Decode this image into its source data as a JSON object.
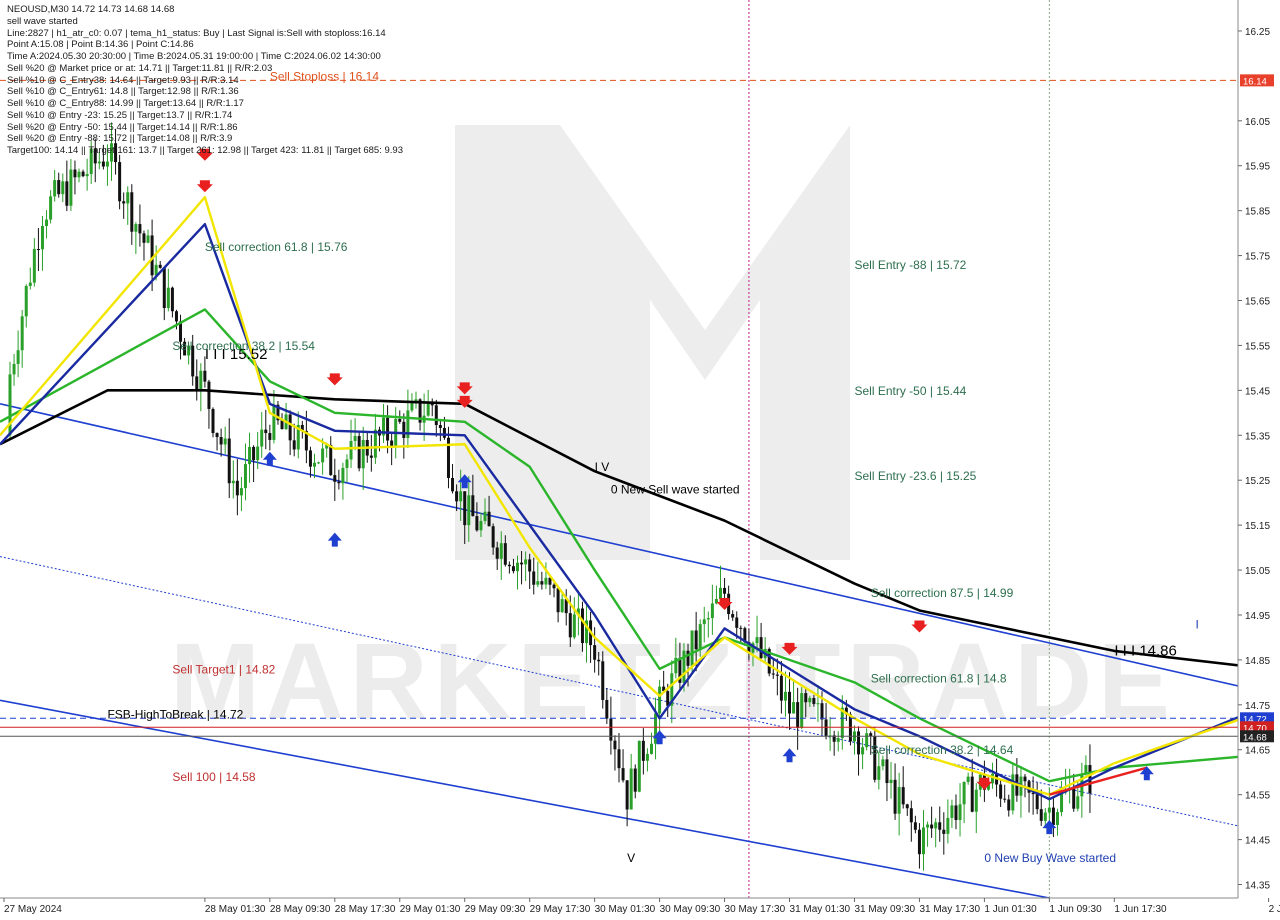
{
  "header": {
    "symbol_line": "NEOUSD,M30  14.72 14.73 14.68 14.68",
    "status": "sell wave started",
    "lines": [
      "Line:2827 | h1_atr_c0: 0.07 | tema_h1_status: Buy | Last Signal is:Sell with stoploss:16.14",
      "Point A:15.08 | Point B:14.36 | Point C:14.86",
      "Time A:2024.05.30 20:30:00 | Time B:2024.05.31 19:00:00 | Time C:2024.06.02 14:30:00",
      "Sell %20 @ Market price or at: 14.71 || Target:11.81 || R/R:2.03",
      "Sell %10 @ C_Entry38: 14.64 || Target:9.93 || R/R:3.14",
      "Sell %10 @ C_Entry61: 14.8 || Target:12.98 || R/R:1.36",
      "Sell %10 @ C_Entry88: 14.99 || Target:13.64 || R/R:1.17",
      "Sell %10 @ Entry -23: 15.25 || Target:13.7 || R/R:1.74",
      "Sell %20 @ Entry -50: 15.44 || Target:14.14 || R/R:1.86",
      "Sell %20 @ Entry -88: 15.72 || Target:14.08 || R/R:3.9",
      "Target100: 14.14 || Target 161: 13.7 || Target 261: 12.98 || Target 423: 11.81 || Target 685: 9.93"
    ]
  },
  "watermark": "MARKETZITRADE",
  "annotations": [
    {
      "text": "Sell Stoploss | 16.14",
      "x": "28 May 09:30",
      "price": 16.14,
      "color": "#e0501a"
    },
    {
      "text": "Sell correction 61.8 | 15.76",
      "x": "28 May 01:30",
      "price": 15.76,
      "color": "#2d6e4e"
    },
    {
      "text": "I I I 15.52",
      "x": "28 May 01:30",
      "price": 15.52,
      "color": "#000000"
    },
    {
      "text": "Sell correction 38.2 | 15.54",
      "x": "27 May 21:30",
      "price": 15.54,
      "color": "#2d6e4e"
    },
    {
      "text": "Sell Entry -88 | 15.72",
      "x": "31 May 09:30",
      "price": 15.72,
      "color": "#2d6e4e"
    },
    {
      "text": "Sell Entry -50 | 15.44",
      "x": "31 May 09:30",
      "price": 15.44,
      "color": "#2d6e4e"
    },
    {
      "text": "Sell Entry -23.6 | 15.25",
      "x": "31 May 09:30",
      "price": 15.25,
      "color": "#2d6e4e"
    },
    {
      "text": "I V",
      "x": "30 May 01:30",
      "price": 15.27,
      "color": "#000000"
    },
    {
      "text": "0 New Sell wave started",
      "x": "30 May 03:30",
      "price": 15.22,
      "color": "#000000"
    },
    {
      "text": "Sell correction 87.5 | 14.99",
      "x": "31 May 11:30",
      "price": 14.99,
      "color": "#2d6e4e"
    },
    {
      "text": "I I I 14.86",
      "x": "1 Jun 17:30",
      "price": 14.86,
      "color": "#000000"
    },
    {
      "text": "I",
      "x": "2 Jun 03:30",
      "price": 14.92,
      "color": "#1f3fb0"
    },
    {
      "text": "Sell Target1 | 14.82",
      "x": "27 May 21:30",
      "price": 14.82,
      "color": "#c03030"
    },
    {
      "text": "Sell correction 61.8 | 14.8",
      "x": "31 May 11:30",
      "price": 14.8,
      "color": "#2d6e4e"
    },
    {
      "text": "FSB-HighToBreak | 14.72",
      "x": "27 May 13:30",
      "price": 14.72,
      "color": "#000000"
    },
    {
      "text": "Sell correction 38.2 | 14.64",
      "x": "31 May 11:30",
      "price": 14.64,
      "color": "#2d6e4e"
    },
    {
      "text": "Sell 100 | 14.58",
      "x": "27 May 21:30",
      "price": 14.58,
      "color": "#c03030"
    },
    {
      "text": "V",
      "x": "30 May 05:30",
      "price": 14.4,
      "color": "#000000"
    },
    {
      "text": "0 New Buy Wave started",
      "x": "1 Jun 01:30",
      "price": 14.4,
      "color": "#1f3fb0"
    }
  ],
  "price_badges": [
    {
      "label": "16.14",
      "price": 16.14,
      "bg": "#e8402a",
      "fg": "#ffffff"
    },
    {
      "label": "14.72",
      "price": 14.72,
      "bg": "#1f3fd0",
      "fg": "#ffffff"
    },
    {
      "label": "14.70",
      "price": 14.7,
      "bg": "#d02020",
      "fg": "#ffffff"
    },
    {
      "label": "14.68",
      "price": 14.68,
      "bg": "#222222",
      "fg": "#ffffff"
    }
  ],
  "chart_data": {
    "type": "candlestick",
    "symbol": "NEOUSD",
    "timeframe": "M30",
    "ylim": [
      14.32,
      16.31
    ],
    "y_ticks": [
      "16.25",
      "16.05",
      "15.95",
      "15.85",
      "15.75",
      "15.65",
      "15.55",
      "15.45",
      "15.35",
      "15.25",
      "15.15",
      "15.05",
      "14.95",
      "14.85",
      "14.75",
      "14.65",
      "14.55",
      "14.45",
      "14.35"
    ],
    "x_ticks": [
      "27 May 2024",
      "28 May 01:30",
      "28 May 09:30",
      "28 May 17:30",
      "29 May 01:30",
      "29 May 09:30",
      "29 May 17:30",
      "30 May 01:30",
      "30 May 09:30",
      "30 May 17:30",
      "31 May 01:30",
      "31 May 09:30",
      "31 May 17:30",
      "1 Jun 01:30",
      "1 Jun 09:30",
      "1 Jun 17:30",
      "2 Jun 12:30"
    ],
    "last_ohlc": {
      "open": 14.72,
      "high": 14.73,
      "low": 14.68,
      "close": 14.68
    },
    "horizontal_levels": [
      {
        "name": "Sell Stoploss",
        "price": 16.14,
        "style": "dashed",
        "color": "#e0501a"
      },
      {
        "name": "FSB-HighToBreak",
        "price": 14.72,
        "style": "dashed",
        "color": "#1f3fd0"
      },
      {
        "name": "Current",
        "price": 14.7,
        "style": "solid",
        "color": "#d02020"
      },
      {
        "name": "Last",
        "price": 14.68,
        "style": "solid",
        "color": "#555555"
      }
    ],
    "vertical_markers": [
      {
        "x": "30 May 20:30",
        "color": "#c0208a",
        "style": "dotted"
      },
      {
        "x": "1 Jun 09:30",
        "color": "#8aaa8a",
        "style": "dotted"
      }
    ],
    "key_closes": [
      {
        "x": "27 May 2024",
        "price": 15.35
      },
      {
        "x": "27 May 05:30",
        "price": 15.85
      },
      {
        "x": "27 May 13:30",
        "price": 15.98
      },
      {
        "x": "28 May 01:30",
        "price": 15.45
      },
      {
        "x": "28 May 05:30",
        "price": 15.22
      },
      {
        "x": "28 May 09:30",
        "price": 15.38
      },
      {
        "x": "28 May 17:30",
        "price": 15.28
      },
      {
        "x": "29 May 01:30",
        "price": 15.37
      },
      {
        "x": "29 May 05:30",
        "price": 15.42
      },
      {
        "x": "29 May 09:30",
        "price": 15.18
      },
      {
        "x": "29 May 17:30",
        "price": 15.05
      },
      {
        "x": "30 May 01:30",
        "price": 14.88
      },
      {
        "x": "30 May 05:30",
        "price": 14.55
      },
      {
        "x": "30 May 09:30",
        "price": 14.75
      },
      {
        "x": "30 May 17:30",
        "price": 15.0
      },
      {
        "x": "31 May 01:30",
        "price": 14.74
      },
      {
        "x": "31 May 09:30",
        "price": 14.7
      },
      {
        "x": "31 May 17:30",
        "price": 14.45
      },
      {
        "x": "1 Jun 01:30",
        "price": 14.58
      },
      {
        "x": "1 Jun 09:30",
        "price": 14.52
      },
      {
        "x": "1 Jun 17:30",
        "price": 14.63
      },
      {
        "x": "2 Jun 05:30",
        "price": 14.68
      },
      {
        "x": "2 Jun 09:30",
        "price": 14.8
      },
      {
        "x": "2 Jun 12:30",
        "price": 14.74
      },
      {
        "x": "2 Jun 16:30",
        "price": 14.68
      }
    ],
    "moving_averages": [
      {
        "color": "#000000",
        "points": [
          [
            "27 May 2024",
            15.33
          ],
          [
            "27 May 13:30",
            15.45
          ],
          [
            "28 May 01:30",
            15.45
          ],
          [
            "28 May 17:30",
            15.43
          ],
          [
            "29 May 09:30",
            15.42
          ],
          [
            "30 May 01:30",
            15.27
          ],
          [
            "30 May 17:30",
            15.16
          ],
          [
            "31 May 09:30",
            15.02
          ],
          [
            "31 May 17:30",
            14.96
          ],
          [
            "1 Jun 17:30",
            14.87
          ],
          [
            "2 Jun 12:30",
            14.83
          ],
          [
            "2 Jun 16:30",
            14.82
          ]
        ]
      },
      {
        "color": "#2ab52a",
        "points": [
          [
            "27 May 2024",
            15.38
          ],
          [
            "28 May 01:30",
            15.63
          ],
          [
            "28 May 09:30",
            15.47
          ],
          [
            "28 May 17:30",
            15.4
          ],
          [
            "29 May 09:30",
            15.38
          ],
          [
            "29 May 17:30",
            15.28
          ],
          [
            "30 May 01:30",
            15.05
          ],
          [
            "30 May 09:30",
            14.83
          ],
          [
            "30 May 17:30",
            14.9
          ],
          [
            "31 May 09:30",
            14.8
          ],
          [
            "31 May 17:30",
            14.72
          ],
          [
            "1 Jun 09:30",
            14.58
          ],
          [
            "1 Jun 17:30",
            14.61
          ],
          [
            "2 Jun 12:30",
            14.64
          ],
          [
            "2 Jun 16:30",
            14.67
          ]
        ]
      },
      {
        "color": "#1a2aa0",
        "points": [
          [
            "27 May 2024",
            15.33
          ],
          [
            "28 May 01:30",
            15.82
          ],
          [
            "28 May 09:30",
            15.42
          ],
          [
            "28 May 17:30",
            15.36
          ],
          [
            "29 May 09:30",
            15.35
          ],
          [
            "29 May 17:30",
            15.15
          ],
          [
            "30 May 01:30",
            14.95
          ],
          [
            "30 May 09:30",
            14.72
          ],
          [
            "30 May 17:30",
            14.92
          ],
          [
            "31 May 09:30",
            14.74
          ],
          [
            "31 May 17:30",
            14.68
          ],
          [
            "1 Jun 09:30",
            14.54
          ],
          [
            "1 Jun 17:30",
            14.61
          ],
          [
            "2 Jun 12:30",
            14.75
          ],
          [
            "2 Jun 16:30",
            14.72
          ]
        ]
      },
      {
        "color": "#f2e600",
        "points": [
          [
            "27 May 2024",
            15.35
          ],
          [
            "28 May 01:30",
            15.88
          ],
          [
            "28 May 09:30",
            15.4
          ],
          [
            "28 May 17:30",
            15.32
          ],
          [
            "29 May 09:30",
            15.33
          ],
          [
            "29 May 17:30",
            15.1
          ],
          [
            "30 May 01:30",
            14.9
          ],
          [
            "30 May 09:30",
            14.77
          ],
          [
            "30 May 17:30",
            14.9
          ],
          [
            "31 May 09:30",
            14.72
          ],
          [
            "31 May 17:30",
            14.64
          ],
          [
            "1 Jun 09:30",
            14.55
          ],
          [
            "1 Jun 17:30",
            14.62
          ],
          [
            "2 Jun 12:30",
            14.74
          ],
          [
            "2 Jun 16:30",
            14.71
          ]
        ]
      }
    ],
    "channel_lines": [
      {
        "style": "solid",
        "color": "#1f3fd0",
        "points": [
          [
            "27 May 2024",
            15.42
          ],
          [
            "2 Jun 16:30",
            14.76
          ]
        ]
      },
      {
        "style": "dotted",
        "color": "#1f3fd0",
        "points": [
          [
            "27 May 2024",
            15.08
          ],
          [
            "2 Jun 16:30",
            14.45
          ]
        ]
      },
      {
        "style": "solid",
        "color": "#1f3fd0",
        "points": [
          [
            "27 May 2024",
            14.76
          ],
          [
            "1 Jun 09:30",
            14.32
          ]
        ]
      }
    ],
    "trend_segments": [
      {
        "color": "#e82020",
        "points": [
          [
            "1 Jun 09:30",
            14.55
          ],
          [
            "1 Jun 21:30",
            14.61
          ]
        ]
      },
      {
        "color": "#e82020",
        "points": [
          [
            "2 Jun 09:30",
            14.87
          ],
          [
            "2 Jun 12:30",
            14.8
          ]
        ]
      }
    ],
    "signals": [
      {
        "type": "sell",
        "x": "28 May 01:30",
        "price": 15.97
      },
      {
        "type": "sell",
        "x": "28 May 01:30",
        "price": 15.9
      },
      {
        "type": "sell",
        "x": "28 May 17:30",
        "price": 15.47
      },
      {
        "type": "sell",
        "x": "29 May 09:30",
        "price": 15.45
      },
      {
        "type": "sell",
        "x": "29 May 09:30",
        "price": 15.42
      },
      {
        "type": "sell",
        "x": "30 May 17:30",
        "price": 14.97
      },
      {
        "type": "sell",
        "x": "31 May 01:30",
        "price": 14.87
      },
      {
        "type": "sell",
        "x": "31 May 17:30",
        "price": 14.92
      },
      {
        "type": "sell",
        "x": "1 Jun 01:30",
        "price": 14.57
      },
      {
        "type": "sell",
        "x": "2 Jun 12:30",
        "price": 14.78
      },
      {
        "type": "buy",
        "x": "28 May 09:30",
        "price": 15.3
      },
      {
        "type": "buy",
        "x": "28 May 17:30",
        "price": 15.12
      },
      {
        "type": "buy",
        "x": "29 May 09:30",
        "price": 15.25
      },
      {
        "type": "buy",
        "x": "30 May 09:30",
        "price": 14.68
      },
      {
        "type": "buy",
        "x": "31 May 01:30",
        "price": 14.64
      },
      {
        "type": "buy",
        "x": "1 Jun 09:30",
        "price": 14.48
      },
      {
        "type": "buy",
        "x": "1 Jun 21:30",
        "price": 14.6
      },
      {
        "type": "buy",
        "x": "2 Jun 09:30",
        "price": 14.78
      }
    ]
  }
}
